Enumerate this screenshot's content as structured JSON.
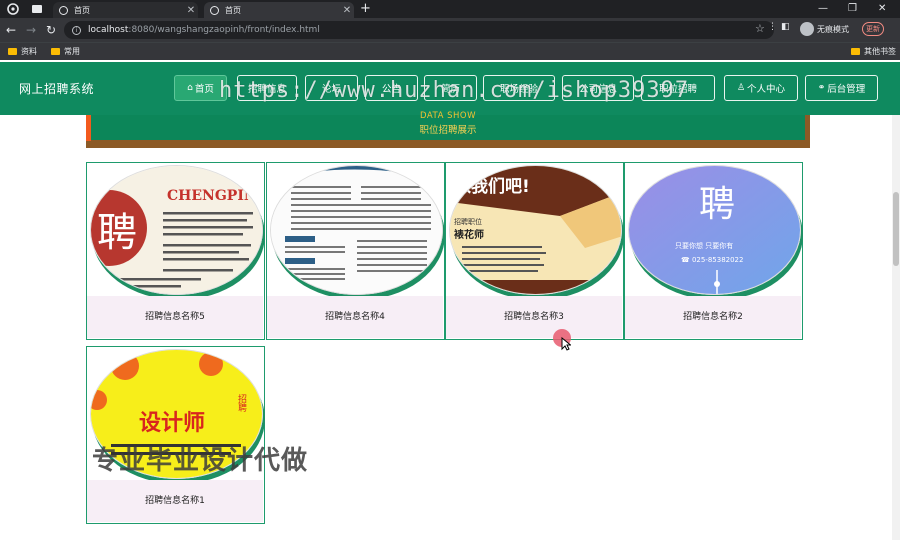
{
  "browser": {
    "tabs": [
      {
        "title": "首页",
        "active": false
      },
      {
        "title": "首页",
        "active": true
      }
    ],
    "url_host": "localhost",
    "url_path": ":8080/wangshangzaopinh/front/index.html",
    "profile_label": "无痕模式",
    "update_label": "更新",
    "bookmarks": [
      "资料",
      "常用"
    ],
    "other_bookmarks": "其他书签"
  },
  "site": {
    "title": "网上招聘系统",
    "nav": [
      {
        "label": "首页",
        "icon": "home-icon",
        "active": true
      },
      {
        "label": "招聘信息",
        "icon": "",
        "active": false
      },
      {
        "label": "论坛",
        "icon": "",
        "active": false
      },
      {
        "label": "公告",
        "icon": "",
        "active": false
      },
      {
        "label": "简历",
        "icon": "",
        "active": false
      },
      {
        "label": "职场经验",
        "icon": "",
        "active": false
      },
      {
        "label": "公司信息",
        "icon": "",
        "active": false
      },
      {
        "label": "职位招聘",
        "icon": "",
        "active": false
      },
      {
        "label": "个人中心",
        "icon": "user-icon",
        "active": false
      },
      {
        "label": "后台管理",
        "icon": "link-icon",
        "active": false
      }
    ]
  },
  "section": {
    "title_en": "DATA SHOW",
    "title_cn": "职位招聘展示"
  },
  "cards": [
    {
      "name": "招聘信息名称5"
    },
    {
      "name": "招聘信息名称4"
    },
    {
      "name": "招聘信息名称3"
    },
    {
      "name": "招聘信息名称2"
    },
    {
      "name": "招聘信息名称1"
    }
  ],
  "card_images": {
    "c5_brand": "CHENGPIN",
    "c5_big": "聘",
    "c3_banner": "入我们吧!",
    "c3_label": "招聘职位",
    "c3_job": "裱花师",
    "c2_big": "聘",
    "c2_tagline": "只要你想  只要你有",
    "c2_phone": "☎ 025-85382022",
    "c1_job": "设计师",
    "c1_side": "招聘"
  },
  "overlays": {
    "watermark": "https://www.huzhan.com/ishop39397",
    "promo": "专业毕业设计代做"
  }
}
